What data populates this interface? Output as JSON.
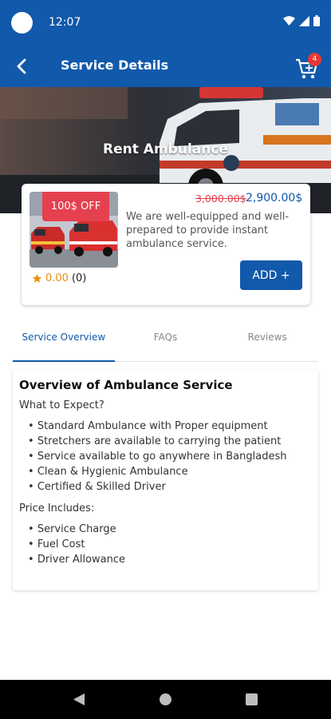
{
  "status_bar": {
    "time": "12:07"
  },
  "app_bar": {
    "title": "Service Details",
    "cart_badge": "4"
  },
  "hero": {
    "title": "Rent Ambulance"
  },
  "service_card": {
    "discount_label": "100$ OFF",
    "old_price": "3,000.00$",
    "new_price": "2,900.00$",
    "description": "We are well-equipped and well-prepared to provide instant ambulance service.",
    "rating": "0.00",
    "rating_count": "(0)",
    "add_label": "ADD +"
  },
  "tabs": [
    {
      "label": "Service Overview"
    },
    {
      "label": "FAQs"
    },
    {
      "label": "Reviews"
    }
  ],
  "overview": {
    "heading": "Overview of Ambulance Service",
    "expect_label": "What to Expect?",
    "expect_items": [
      "Standard Ambulance with Proper equipment",
      "Stretchers are available to carrying the patient",
      "Service available to go anywhere in Bangladesh",
      "Clean & Hygienic Ambulance",
      "Certified & Skilled Driver"
    ],
    "includes_label": "Price Includes:",
    "includes_items": [
      "Service Charge",
      "Fuel Cost",
      "Driver Allowance"
    ]
  },
  "colors": {
    "primary": "#1159ab",
    "discount": "#e5404f",
    "rating": "#e88f0c"
  }
}
